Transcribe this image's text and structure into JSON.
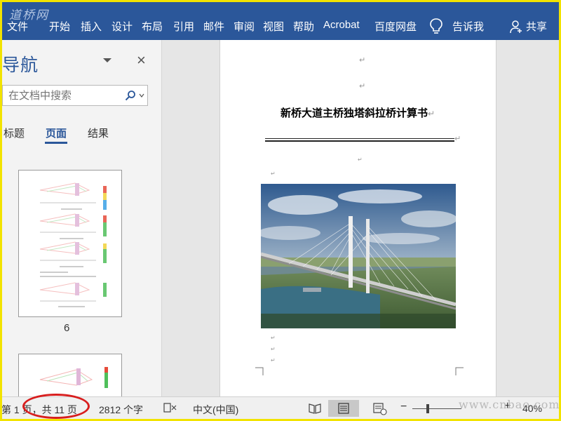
{
  "watermark": "道桥网",
  "ribbon": {
    "tabs": [
      "文件",
      "开始",
      "插入",
      "设计",
      "布局",
      "引用",
      "邮件",
      "审阅",
      "视图",
      "帮助",
      "Acrobat",
      "百度网盘"
    ],
    "tell_me": "告诉我",
    "share": "共享"
  },
  "nav": {
    "title": "导航",
    "search_placeholder": "在文档中搜索",
    "tabs": [
      "标题",
      "页面",
      "结果"
    ],
    "active_tab": "页面",
    "thumb_page_number": "6"
  },
  "document": {
    "title": "新桥大道主桥独塔斜拉桥计算书",
    "para_mark": "↵",
    "image_alt": "cable-stayed bridge photo"
  },
  "status": {
    "page_info": "第 1 页，共 11 页",
    "word_count": "2812 个字",
    "language": "中文(中国)",
    "zoom_minus": "−",
    "zoom_plus": "+",
    "zoom_level": "40%",
    "zoom_fraction": 0.4
  },
  "bottom_watermark": "www.cnbao.com",
  "colors": {
    "ribbon": "#2b579a",
    "accent": "#2b579a",
    "annotation_ellipse": "#d81e1e",
    "frame_border": "#f2e300"
  }
}
